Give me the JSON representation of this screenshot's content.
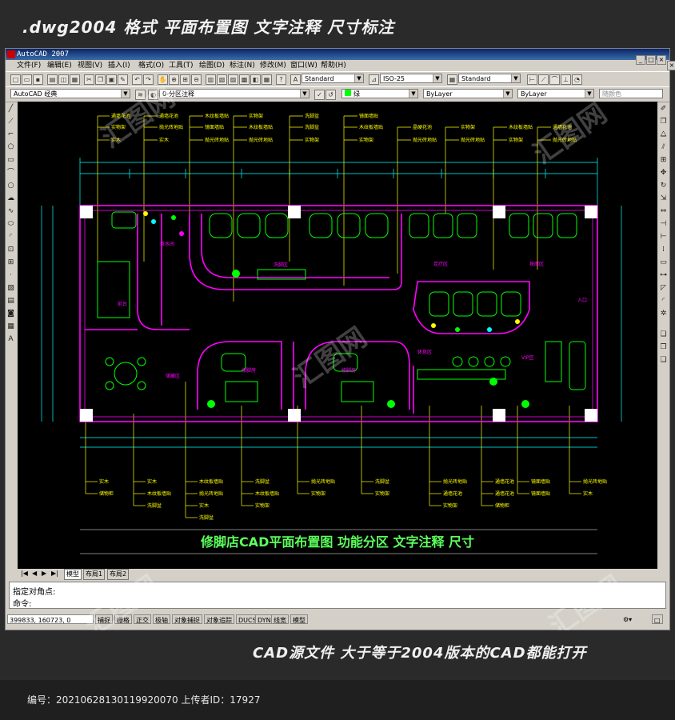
{
  "banner_top": ".dwg2004 格式  平面布置图 文字注释 尺寸标注",
  "app": {
    "title": "AutoCAD 2007",
    "menu": [
      "文件(F)",
      "编辑(E)",
      "视图(V)",
      "插入(I)",
      "格式(O)",
      "工具(T)",
      "绘图(D)",
      "标注(N)",
      "修改(M)",
      "窗口(W)",
      "帮助(H)"
    ],
    "text_style": "Standard",
    "dim_style": "ISO-25",
    "table_style": "Standard",
    "workspace": "AutoCAD 经典",
    "layer": "0-分区注释",
    "color": "绿",
    "linetype": "ByLayer",
    "lineweight": "ByLayer",
    "plotstyle": "随颜色",
    "tabs": [
      "模型",
      "布局1",
      "布局2"
    ],
    "cmd_line1": "指定对角点:",
    "cmd_line2": "命令:",
    "coords": "399833, 160723, 0",
    "status_buttons": [
      "捕捉",
      "栅格",
      "正交",
      "极轴",
      "对象捕捉",
      "对象追踪",
      "DUCS",
      "DYN",
      "线宽",
      "模型"
    ]
  },
  "drawing": {
    "caption": "修脚店CAD平面布置图   功能分区   文字注释   尺寸",
    "room_labels": [
      "洗脚区",
      "足疗区",
      "休息区",
      "前台",
      "卫生间",
      "收银台",
      "茶水间",
      "储藏区",
      "修脚房",
      "修脚房",
      "VIP区",
      "按摩区",
      "入口"
    ],
    "callouts_top": [
      "通墙花池",
      "通墙花池",
      "木纹板墙贴",
      "实物架",
      "洗脚盆",
      "镜面墙贴",
      "晶硬花池",
      "实物架",
      "木纹板墙贴",
      "通墙花池",
      "实物架",
      "抛光砖地贴"
    ],
    "callouts_bottom": [
      "实木",
      "储物柜",
      "实木",
      "木纹板墙贴",
      "抛光砖地贴",
      "洗脚盆",
      "抛光砖地贴",
      "洗脚盆",
      "抛光砖地贴",
      "通墙花池",
      "镜面墙贴",
      "抛光砖地贴"
    ]
  },
  "banner_bottom": "CAD源文件  大于等于2004版本的CAD都能打开",
  "footer": "编号：20210628130119920070 上传者ID：17927",
  "colors": {
    "canvas": "#000000",
    "wall": "#ff00ff",
    "furniture": "#00ff00",
    "callout": "#ffff00",
    "dimension": "#00ffff"
  }
}
